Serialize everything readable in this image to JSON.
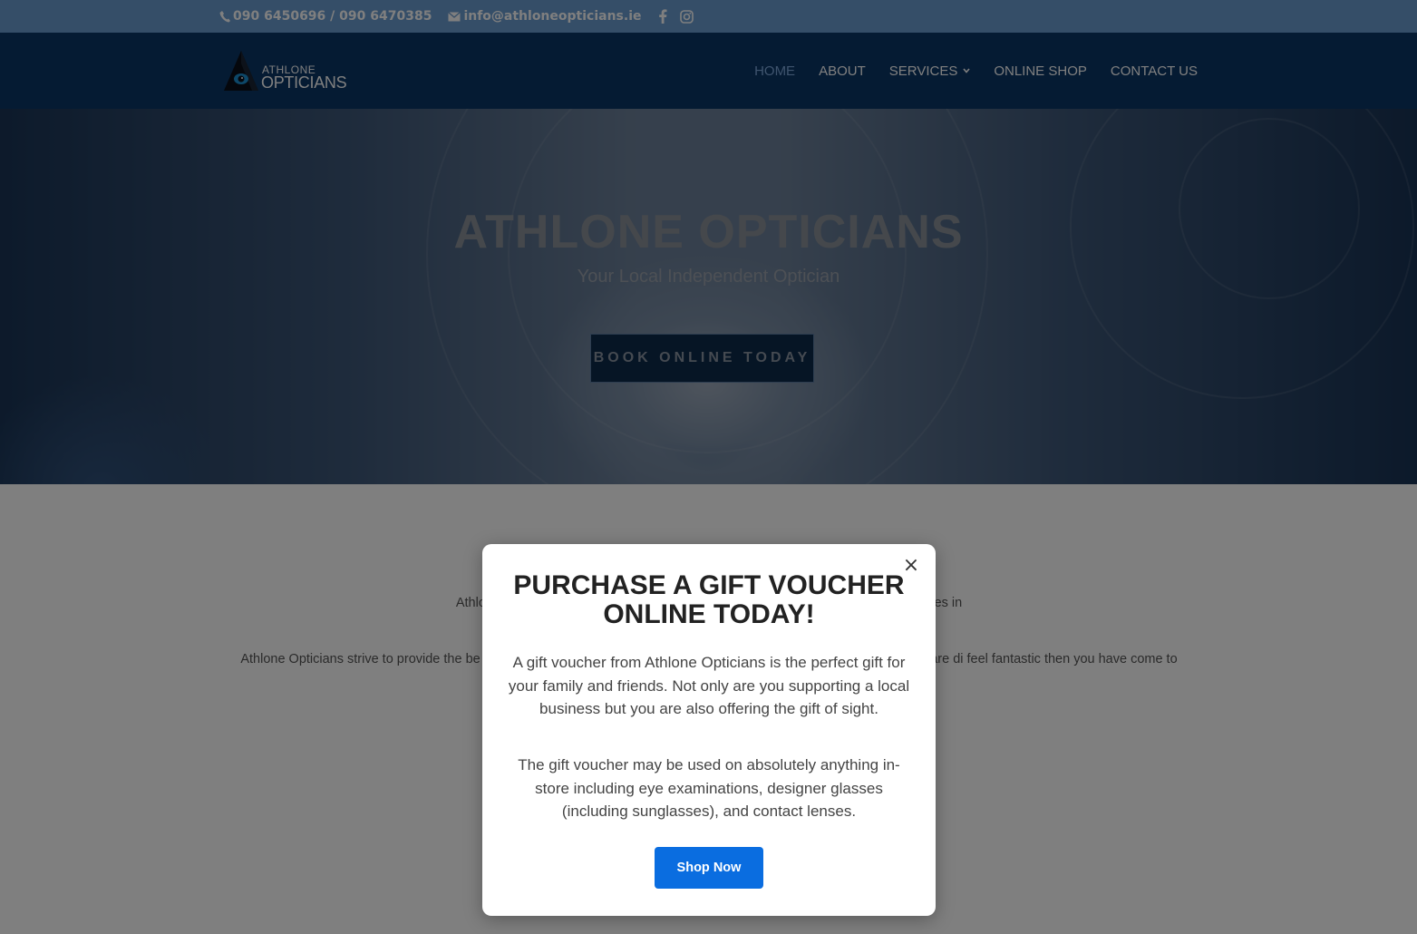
{
  "topbar": {
    "phone": "090 6450696 / 090 6470385",
    "email": "info@athloneopticians.ie",
    "social": [
      "facebook-icon",
      "instagram-icon"
    ],
    "bg_color": "#6b9cd0"
  },
  "header": {
    "logo_line1": "ATHLONE",
    "logo_line2": "OPTICIANS",
    "bg_color": "#0b3666",
    "nav": [
      {
        "label": "HOME",
        "active": true
      },
      {
        "label": "ABOUT"
      },
      {
        "label": "SERVICES",
        "has_dropdown": true
      },
      {
        "label": "ONLINE SHOP"
      },
      {
        "label": "CONTACT US"
      }
    ]
  },
  "hero": {
    "title": "ATHLONE OPTICIANS",
    "subtitle": "Your Local Independent Optician",
    "button": "BOOK ONLINE TODAY"
  },
  "content": {
    "para1": "Athlone Opticians is a boutique opticians lo                                                                                                         ptometrist Valerie Donegan who believes in",
    "para2": "Athlone Opticians strive to provide the be                                                                                                         ronment. If you would like a thorough eye exam where your individual needs are di                                                                                                        feel fantastic then you have come to the"
  },
  "modal": {
    "title": "PURCHASE A GIFT VOUCHER ONLINE TODAY!",
    "p1": "A gift voucher from Athlone Opticians is the perfect gift for your family and friends. Not only are you supporting a local business but you are also offering the gift of sight.",
    "p2": "The gift voucher may be used on absolutely anything in-store including eye examinations, designer glasses (including sunglasses), and contact lenses.",
    "button": "Shop Now",
    "close": "×",
    "accent": "#0a6de0"
  }
}
